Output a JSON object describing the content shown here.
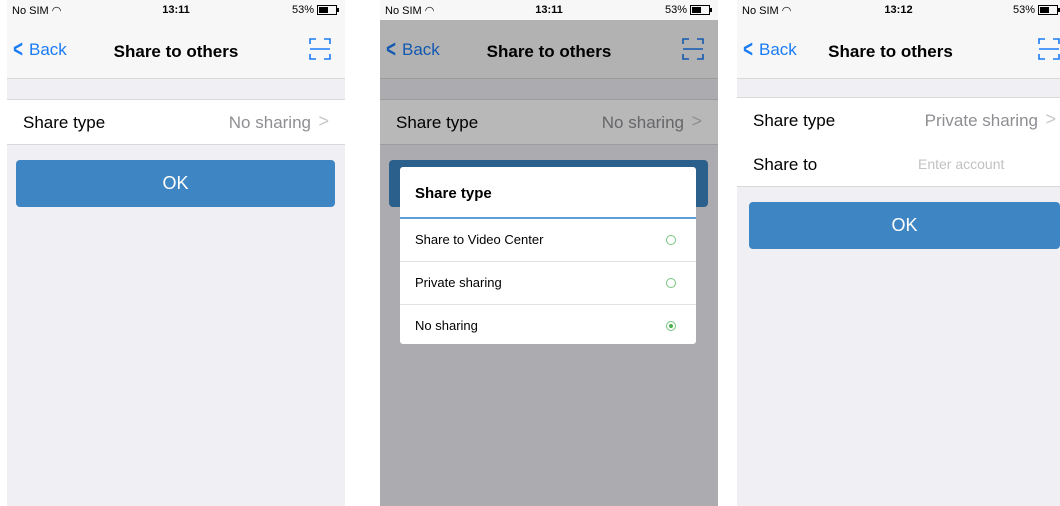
{
  "screens": [
    {
      "status": {
        "carrier": "No SIM",
        "time": "13:11",
        "battery": "53%"
      },
      "nav": {
        "back": "Back",
        "title": "Share to others"
      },
      "share_type": {
        "label": "Share type",
        "value": "No sharing"
      },
      "ok": "OK"
    },
    {
      "status": {
        "carrier": "No SIM",
        "time": "13:11",
        "battery": "53%"
      },
      "nav": {
        "back": "Back",
        "title": "Share to others"
      },
      "share_type": {
        "label": "Share type",
        "value": "No sharing"
      },
      "dialog": {
        "title": "Share type",
        "options": [
          {
            "label": "Share to Video Center",
            "selected": false
          },
          {
            "label": "Private sharing",
            "selected": false
          },
          {
            "label": "No sharing",
            "selected": true
          }
        ]
      }
    },
    {
      "status": {
        "carrier": "No SIM",
        "time": "13:12",
        "battery": "53%"
      },
      "nav": {
        "back": "Back",
        "title": "Share to others"
      },
      "share_type": {
        "label": "Share type",
        "value": "Private sharing"
      },
      "share_to": {
        "label": "Share to",
        "placeholder": "Enter account"
      },
      "ok": "OK"
    }
  ],
  "colors": {
    "accent": "#1a7cf5",
    "button": "#3e86c3",
    "radio": "#4caf50"
  },
  "icons": {
    "back": "chevron-left-icon",
    "scan": "scan-frame-icon",
    "arrow": "chevron-right-icon",
    "wifi": "wifi-icon"
  }
}
